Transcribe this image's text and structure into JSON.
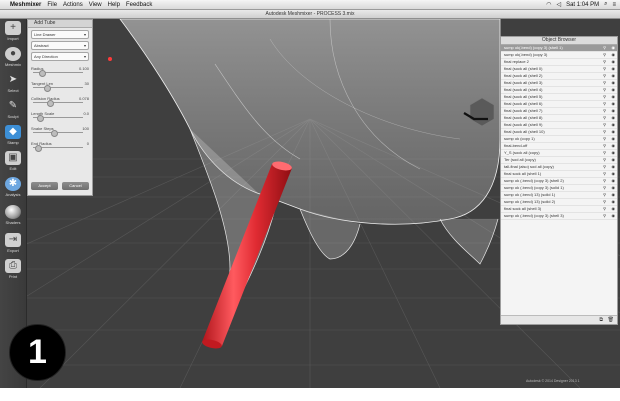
{
  "menubar": {
    "app_name": "Meshmixer",
    "items": [
      "File",
      "Actions",
      "View",
      "Help",
      "Feedback"
    ],
    "clock": "Sat 1:04 PM"
  },
  "window": {
    "title": "Autodesk Meshmixer - PROCESS 3.mix"
  },
  "toolbar": {
    "tools": [
      {
        "label": "Import",
        "icon": "plus-icon"
      },
      {
        "label": "Meshmix",
        "icon": "meshmix-icon"
      },
      {
        "label": "Select",
        "icon": "select-arrow-icon"
      },
      {
        "label": "Sculpt",
        "icon": "brush-icon"
      },
      {
        "label": "Stamp",
        "icon": "stamp-icon"
      },
      {
        "label": "Edit",
        "icon": "edit-icon"
      },
      {
        "label": "Analysis",
        "icon": "analysis-icon"
      },
      {
        "label": "Shaders",
        "icon": "shader-sphere-icon"
      },
      {
        "label": "Export",
        "icon": "export-icon"
      },
      {
        "label": "Print",
        "icon": "print-icon"
      }
    ]
  },
  "add_tube": {
    "title": "Add Tube",
    "dropdowns": [
      "Line Drawer",
      "Abstract",
      "Any Direction"
    ],
    "params": [
      {
        "label": "Radius",
        "value": "0.100"
      },
      {
        "label": "Tangent Len",
        "value": "30"
      },
      {
        "label": "Collision Radius",
        "value": "0.078"
      },
      {
        "label": "Length Scale",
        "value": "0.0"
      },
      {
        "label": "Snake Steps",
        "value": "100"
      },
      {
        "label": "End Radius",
        "value": "0"
      }
    ],
    "accept_label": "Accept",
    "cancel_label": "Cancel"
  },
  "object_browser": {
    "title": "Object Browser",
    "items": [
      "sump ok(.bend) (copy 3) (shell 1)",
      "sump ok(.bend) (copy 3)",
      "final replace 2",
      "final (sock all (shell 0)",
      "final (sock all (shell 2)",
      "final (sock all (shell 3)",
      "final (sock all (shell 4)",
      "final (sock all (shell 5)",
      "final (sock all (shell 6)",
      "final (sock all (shell 7)",
      "final (sock all (shell 8)",
      "final (sock all (shell 9)",
      "final (sock all (shell 10)",
      "sump ok (copy 1)",
      "final-bend-off",
      "Y_S (sock all (copy)",
      "Ter (sod all (copy)",
      "tall-final (also) sod all (copy)",
      "final sock all (shell 1)",
      "sump ok (.bend) (copy 3) (shell 2)",
      "sump ok (.bend) (copy 3) (solid 1)",
      "sump ok (.bend) 13) (solid 1)",
      "sump ok (.bend) 13) (solid 2)",
      "final sock all (shell 3)",
      "sump ok (.bend) (copy 3) (shell 3)"
    ]
  },
  "step_badge": "1",
  "footnote": "Autodesk © 2014 Designer 2013 1"
}
